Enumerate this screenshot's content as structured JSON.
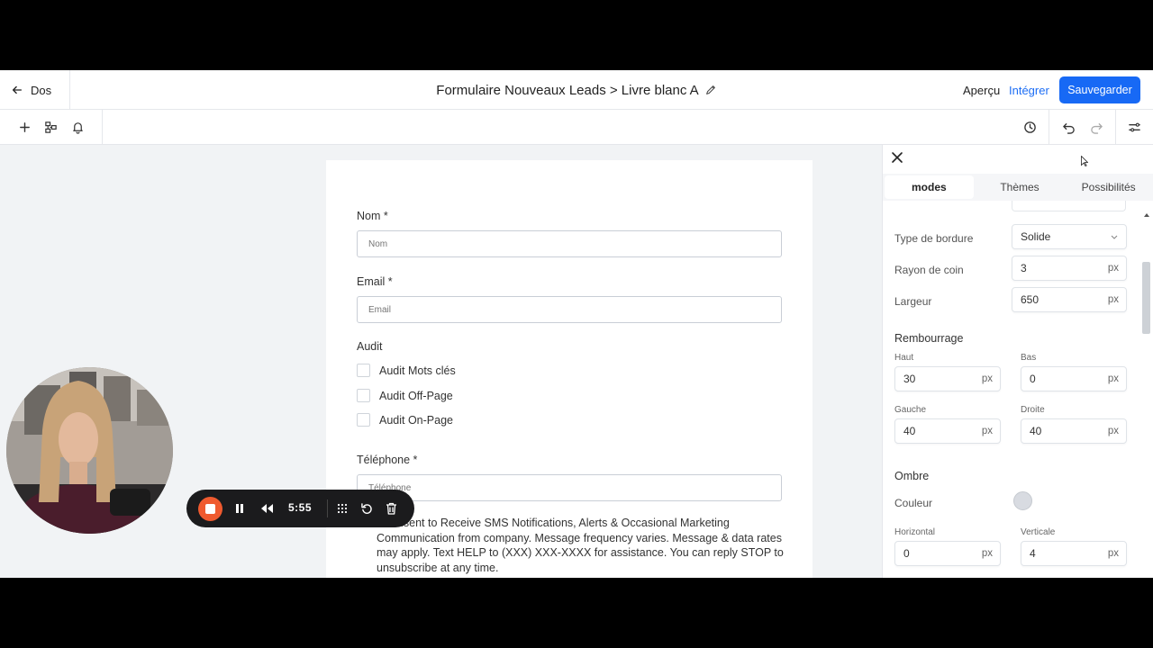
{
  "header": {
    "back_label": "Dos",
    "title": "Formulaire Nouveaux Leads > Livre blanc A",
    "preview_label": "Aperçu",
    "integrate_label": "Intégrer",
    "save_label": "Sauvegarder"
  },
  "form": {
    "name_label": "Nom *",
    "name_placeholder": "Nom",
    "email_label": "Email *",
    "email_placeholder": "Email",
    "audit_label": "Audit",
    "audit_options": [
      "Audit Mots clés",
      "Audit Off-Page",
      "Audit On-Page"
    ],
    "phone_label": "Téléphone *",
    "phone_placeholder": "Téléphone",
    "consent_text": "I Consent to Receive SMS Notifications, Alerts & Occasional Marketing Communication from company. Message frequency varies. Message & data rates may apply. Text HELP to (XXX) XXX-XXXX for assistance. You can reply STOP to unsubscribe at any time."
  },
  "panel": {
    "tabs": [
      "modes",
      "Thèmes",
      "Possibilités"
    ],
    "active_tab": "modes",
    "border_type_label": "Type de bordure",
    "border_type_value": "Solide",
    "corner_radius_label": "Rayon de coin",
    "corner_radius_value": "3",
    "width_label": "Largeur",
    "width_value": "650",
    "unit": "px",
    "padding_section": "Rembourrage",
    "padding": {
      "top_label": "Haut",
      "top_value": "30",
      "bottom_label": "Bas",
      "bottom_value": "0",
      "left_label": "Gauche",
      "left_value": "40",
      "right_label": "Droite",
      "right_value": "40"
    },
    "shadow_section": "Ombre",
    "shadow_color_label": "Couleur",
    "shadow_color": "#d8dbe1",
    "shadow": {
      "horizontal_label": "Horizontal",
      "horizontal_value": "0",
      "vertical_label": "Verticale",
      "vertical_value": "4"
    }
  },
  "recorder": {
    "time": "5:55"
  },
  "colors": {
    "accent": "#1769f5",
    "record": "#ef5a2f"
  }
}
